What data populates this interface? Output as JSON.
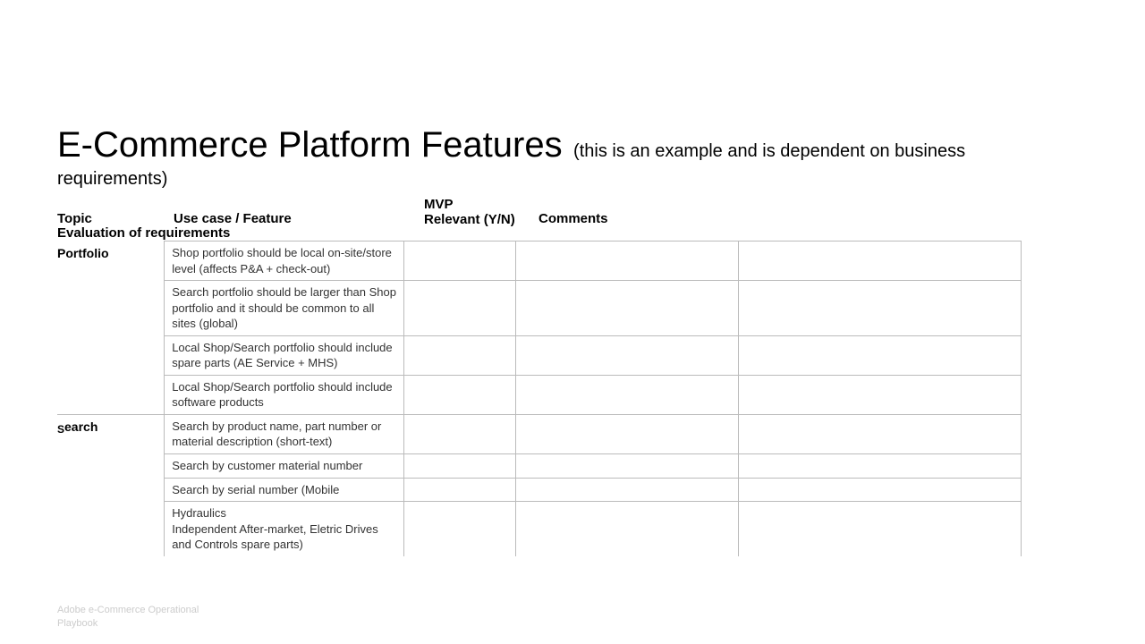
{
  "title": "E-Commerce Platform Features",
  "subtitle_part1": "(this is an example and is dependent on business",
  "subtitle_part2": "requirements)",
  "headers": {
    "topic": "Topic",
    "feature": "Use case / Feature",
    "mvp_line1": "MVP",
    "mvp_line2": "Relevant (Y/N)",
    "comments": "Comments"
  },
  "section_heading": "Evaluation of requirements",
  "groups": [
    {
      "topic": "Portfolio",
      "rows": [
        "Shop portfolio should be local on-site/store level (affects P&A + check-out)",
        "Search portfolio should be larger than Shop  portfolio and it should be common to all sites  (global)",
        "Local Shop/Search portfolio should include  spare parts (AE Service + MHS)",
        "Local Shop/Search portfolio should include  software products"
      ]
    },
    {
      "topic": "Search",
      "topic_prefix": "S",
      "rows": [
        "Search by product name, part number or  material description (short-text)",
        "Search by customer material number",
        "Search by serial number (Mobile",
        "Hydraulics\nIndependent After-market, Eletric Drives and  Controls spare parts)"
      ]
    }
  ],
  "footer": "Adobe e-Commerce Operational Playbook"
}
